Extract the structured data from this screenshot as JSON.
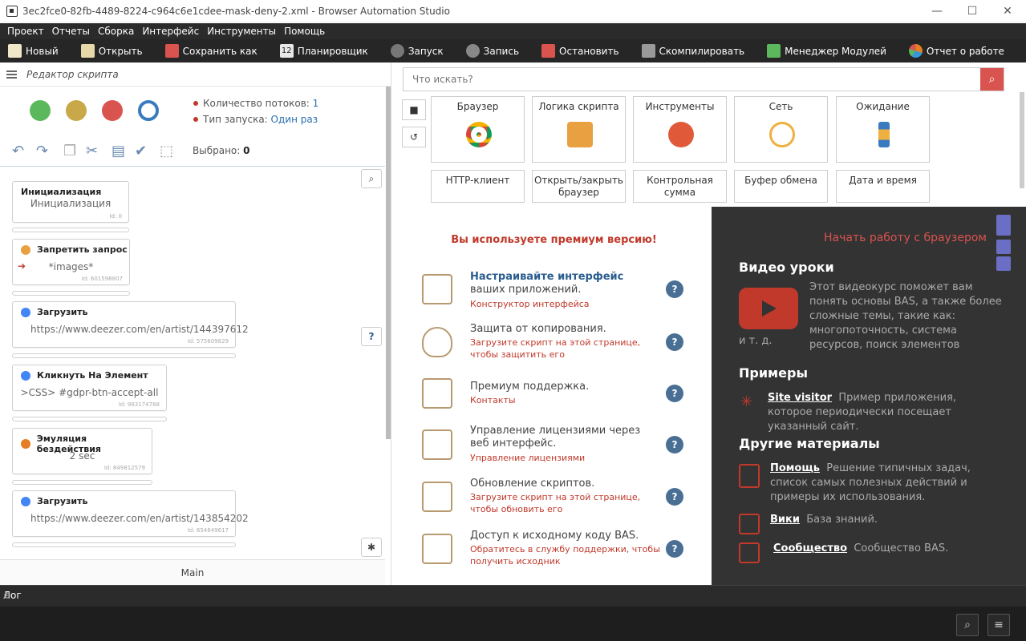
{
  "window": {
    "title": "3ec2fce0-82fb-4489-8224-c964c6e1cdee-mask-deny-2.xml - Browser Automation Studio"
  },
  "menu": [
    "Проект",
    "Отчеты",
    "Сборка",
    "Интерфейс",
    "Инструменты",
    "Помощь"
  ],
  "toolbar": [
    {
      "label": "Новый",
      "icon": "new-file-icon",
      "color": "#f0e6c8"
    },
    {
      "label": "Открыть",
      "icon": "open-file-icon",
      "color": "#e8d9a8"
    },
    {
      "label": "Сохранить как",
      "icon": "save-icon",
      "color": "#d9534f"
    },
    {
      "label": "Планировщик",
      "icon": "calendar-icon",
      "color": "#e8e8e8"
    },
    {
      "label": "Запуск",
      "icon": "play-icon",
      "color": "#777777"
    },
    {
      "label": "Запись",
      "icon": "record-icon",
      "color": "#888888"
    },
    {
      "label": "Остановить",
      "icon": "stop-icon",
      "color": "#d9534f"
    },
    {
      "label": "Скомпилировать",
      "icon": "cube-icon",
      "color": "#999999"
    },
    {
      "label": "Менеджер Модулей",
      "icon": "puzzle-icon",
      "color": "#5cb85c"
    },
    {
      "label": "Отчет о работе",
      "icon": "pie-chart-icon",
      "color": "#e67e22"
    }
  ],
  "editor": {
    "title": "Редактор скрипта",
    "threads_label": "Количество потоков:",
    "threads_value": "1",
    "launch_label": "Тип запуска:",
    "launch_value": "Один раз",
    "selected_label": "Выбрано:",
    "selected_value": "0",
    "tab": "Main",
    "blocks": [
      {
        "title": "Инициализация",
        "content": "Инициализация",
        "id": "Id: 0",
        "icon_color": "transparent"
      },
      {
        "title": "Запретить запрос",
        "content": "*images*",
        "id": "Id: 601598807",
        "icon_color": "#e8a040"
      },
      {
        "title": "Загрузить",
        "content": "https://www.deezer.com/en/artist/144397612",
        "id": "Id: 575609829",
        "icon_color": "#4285f4"
      },
      {
        "title": "Кликнуть На Элемент",
        "content": ">CSS> #gdpr-btn-accept-all",
        "id": "Id: 983174768",
        "icon_color": "#4285f4"
      },
      {
        "title": "Эмуляция бездействия",
        "content": "2 sec",
        "id": "Id: 849812579",
        "icon_color": "#e67e22"
      },
      {
        "title": "Загрузить",
        "content": "https://www.deezer.com/en/artist/143854202",
        "id": "Id: 654849617",
        "icon_color": "#4285f4"
      }
    ]
  },
  "actions": {
    "search_placeholder": "Что искать?",
    "tiles": [
      {
        "label": "Браузер",
        "icon": "chrome-icon",
        "color": "#4285f4"
      },
      {
        "label": "Логика скрипта",
        "icon": "puzzle-icon",
        "color": "#e8a040"
      },
      {
        "label": "Инструменты",
        "icon": "wrench-icon",
        "color": "#e05a3a"
      },
      {
        "label": "Сеть",
        "icon": "antenna-icon",
        "color": "#f0b040"
      },
      {
        "label": "Ожидание",
        "icon": "hourglass-icon",
        "color": "#3a7bbf"
      },
      {
        "label": "HTTP-клиент",
        "icon": "http-icon",
        "color": "#ffffff"
      },
      {
        "label": "Открыть/закрыть браузер",
        "icon": "browser-icon",
        "color": "#ffffff"
      },
      {
        "label": "Контрольная сумма",
        "icon": "checksum-icon",
        "color": "#ffffff"
      },
      {
        "label": "Буфер обмена",
        "icon": "clipboard-icon",
        "color": "#ffffff"
      },
      {
        "label": "Дата и время",
        "icon": "calendar-icon",
        "color": "#ffffff"
      }
    ]
  },
  "premium": {
    "title": "Вы используете премиум версию!",
    "items": [
      {
        "text_bold": "Настраивайте интерфейс",
        "text": " ваших приложений.",
        "link": "Конструктор интерфейса",
        "icon": "monitor-icon"
      },
      {
        "text_bold": "",
        "text": "Защита от копирования.",
        "link": "Загрузите скрипт на этой странице, чтобы защитить его",
        "icon": "shield-icon"
      },
      {
        "text_bold": "",
        "text": "Премиум поддержка.",
        "link": "Контакты",
        "icon": "support-icon"
      },
      {
        "text_bold": "",
        "text": "Управление лицензиями через веб интерфейс.",
        "link": "Управление лицензиями",
        "icon": "users-icon"
      },
      {
        "text_bold": "",
        "text": "Обновление скриптов.",
        "link": "Загрузите скрипт на этой странице, чтобы обновить его",
        "icon": "code-window-icon"
      },
      {
        "text_bold": "",
        "text": "Доступ к исходному коду BAS.",
        "link": "Обратитесь в службу поддержки, чтобы получить исходник",
        "icon": "source-code-icon"
      }
    ]
  },
  "info": {
    "start_link": "Начать работу с браузером",
    "video_title": "Видео уроки",
    "video_desc": "Этот видеокурс поможет вам понять основы BAS, а также более сложные темы, такие как: многопоточность, система ресурсов, поиск элементов",
    "video_desc_end": "и т. д.",
    "examples_title": "Примеры",
    "site_visitor_link": "Site visitor",
    "site_visitor_desc": "Пример приложения, которое периодически посещает указанный сайт.",
    "other_title": "Другие материалы",
    "help_link": "Помощь",
    "help_desc": "Решение типичных задач, список самых полезных действий и примеры их использования.",
    "wiki_link": "Вики",
    "wiki_desc": "База знаний.",
    "community_link": "Сообщество",
    "community_desc": "Сообщество BAS."
  },
  "log": {
    "title": "Лог"
  }
}
